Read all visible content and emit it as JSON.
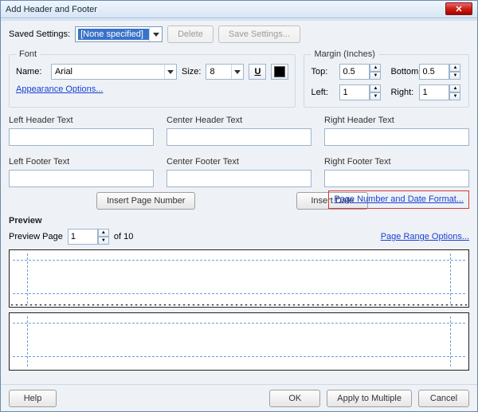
{
  "window": {
    "title": "Add Header and Footer"
  },
  "saved_settings": {
    "label": "Saved Settings:",
    "selected": "[None specified]",
    "delete_label": "Delete",
    "save_label": "Save Settings..."
  },
  "font": {
    "legend": "Font",
    "name_label": "Name:",
    "name_value": "Arial",
    "size_label": "Size:",
    "size_value": "8",
    "appearance_link": "Appearance Options..."
  },
  "margin": {
    "legend": "Margin (Inches)",
    "top_label": "Top:",
    "top_value": "0.5",
    "bottom_label": "Bottom:",
    "bottom_value": "0.5",
    "left_label": "Left:",
    "left_value": "1",
    "right_label": "Right:",
    "right_value": "1"
  },
  "hf": {
    "left_header": "Left Header Text",
    "center_header": "Center Header Text",
    "right_header": "Right Header Text",
    "left_footer": "Left Footer Text",
    "center_footer": "Center Footer Text",
    "right_footer": "Right Footer Text"
  },
  "insert": {
    "page_number": "Insert Page Number",
    "date": "Insert Date",
    "format_link": "Page Number and Date Format..."
  },
  "preview": {
    "legend": "Preview",
    "page_label": "Preview Page",
    "page_value": "1",
    "of_text": "of 10",
    "range_link": "Page Range Options..."
  },
  "footer": {
    "help": "Help",
    "ok": "OK",
    "apply": "Apply to Multiple",
    "cancel": "Cancel"
  }
}
